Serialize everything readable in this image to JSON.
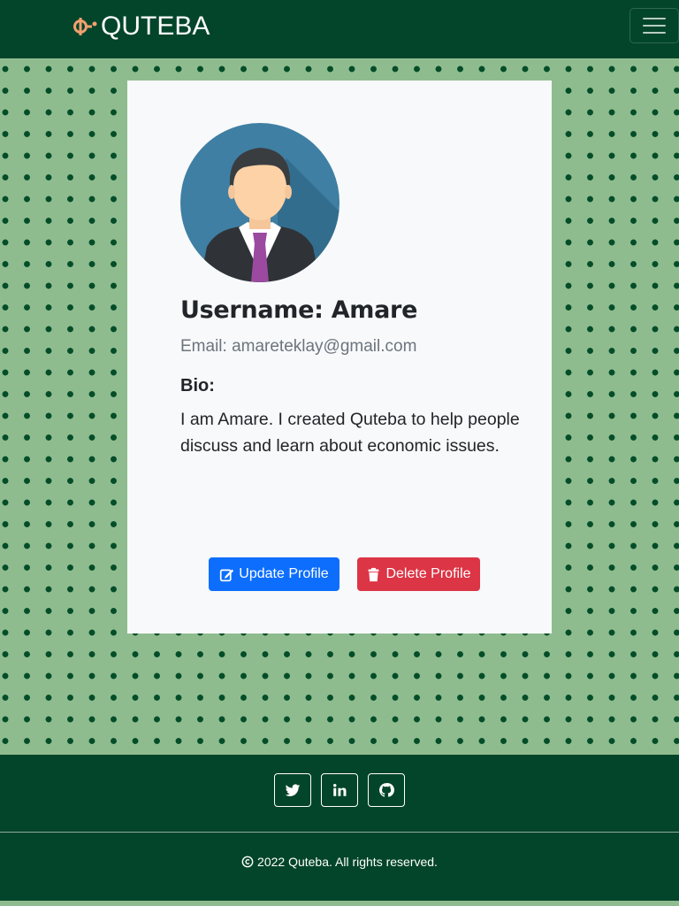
{
  "navbar": {
    "brand_text": "QUTEBA",
    "brand_icon": "quteba-logo-icon",
    "toggler_icon": "hamburger-menu-icon"
  },
  "profile": {
    "avatar": "user-avatar-icon",
    "username": "Username: Amare",
    "email": "Email: amareteklay@gmail.com",
    "bio_title": "Bio:",
    "bio_text": "I am Amare. I created Quteba to help people discuss and learn about economic issues.",
    "update_button": "Update Profile",
    "delete_button": "Delete Profile"
  },
  "footer": {
    "social": [
      "twitter-icon",
      "linkedin-icon",
      "github-icon"
    ],
    "copyright": "2022 Quteba. All rights reserved."
  },
  "colors": {
    "navbar": "#03452a",
    "background": "#8fbc8f",
    "brand_accent": "#f4a070",
    "primary": "#0d6efd",
    "danger": "#dc3545",
    "card": "#f8f9fa"
  }
}
